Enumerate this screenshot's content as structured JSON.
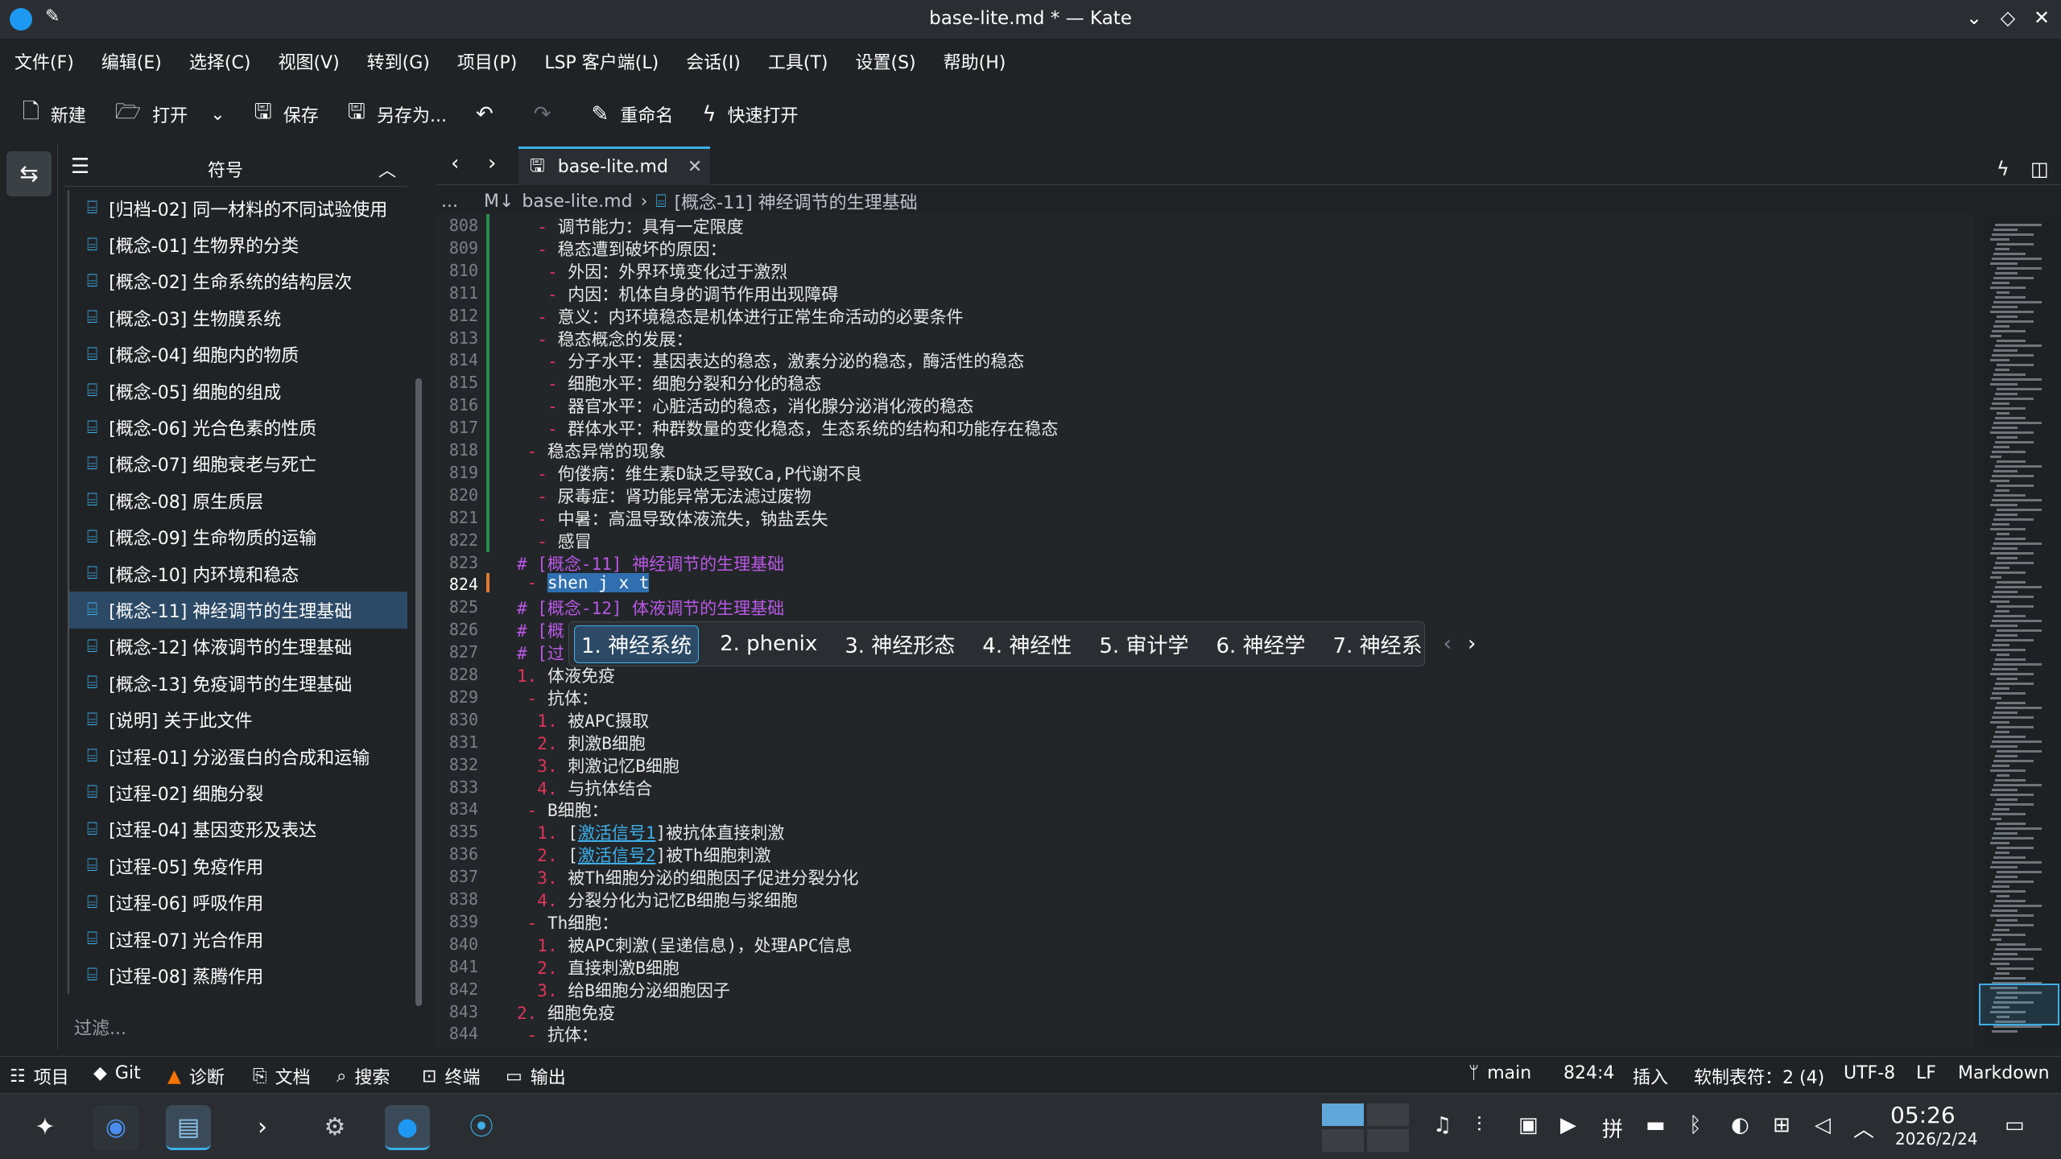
{
  "window": {
    "title": "base-lite.md * — Kate"
  },
  "menu": [
    "文件(F)",
    "编辑(E)",
    "选择(C)",
    "视图(V)",
    "转到(G)",
    "项目(P)",
    "LSP 客户端(L)",
    "会话(I)",
    "工具(T)",
    "设置(S)",
    "帮助(H)"
  ],
  "toolbar": {
    "new": "新建",
    "open": "打开",
    "save": "保存",
    "save_as": "另存为...",
    "rename": "重命名",
    "quick_open": "快速打开"
  },
  "symbols": {
    "title": "符号",
    "items": [
      "[归档-02] 同一材料的不同试验使用",
      "[概念-01] 生物界的分类",
      "[概念-02] 生命系统的结构层次",
      "[概念-03] 生物膜系统",
      "[概念-04] 细胞内的物质",
      "[概念-05] 细胞的组成",
      "[概念-06] 光合色素的性质",
      "[概念-07] 细胞衰老与死亡",
      "[概念-08] 原生质层",
      "[概念-09] 生命物质的运输",
      "[概念-10] 内环境和稳态",
      "[概念-11] 神经调节的生理基础",
      "[概念-12] 体液调节的生理基础",
      "[概念-13] 免疫调节的生理基础",
      "[说明] 关于此文件",
      "[过程-01] 分泌蛋白的合成和运输",
      "[过程-02] 细胞分裂",
      "[过程-04] 基因变形及表达",
      "[过程-05] 免疫作用",
      "[过程-06] 呼吸作用",
      "[过程-07] 光合作用",
      "[过程-08] 蒸腾作用"
    ],
    "selected_index": 11,
    "filter_placeholder": "过滤..."
  },
  "tab": {
    "label": "base-lite.md"
  },
  "breadcrumb": {
    "ellipsis": "...",
    "file": "base-lite.md",
    "section": "[概念-11] 神经调节的生理基础"
  },
  "editor": {
    "lines": [
      {
        "n": "808",
        "indent": "  ",
        "mark": "-",
        "text": " 调节能力：具有一定限度"
      },
      {
        "n": "809",
        "indent": "  ",
        "mark": "-",
        "text": " 稳态遭到破坏的原因："
      },
      {
        "n": "810",
        "indent": "   ",
        "mark": "-",
        "text": " 外因：外界环境变化过于激烈"
      },
      {
        "n": "811",
        "indent": "   ",
        "mark": "-",
        "text": " 内因：机体自身的调节作用出现障碍"
      },
      {
        "n": "812",
        "indent": "  ",
        "mark": "-",
        "text": " 意义：内环境稳态是机体进行正常生命活动的必要条件"
      },
      {
        "n": "813",
        "indent": "  ",
        "mark": "-",
        "text": " 稳态概念的发展："
      },
      {
        "n": "814",
        "indent": "   ",
        "mark": "-",
        "text": " 分子水平：基因表达的稳态，激素分泌的稳态，酶活性的稳态"
      },
      {
        "n": "815",
        "indent": "   ",
        "mark": "-",
        "text": " 细胞水平：细胞分裂和分化的稳态"
      },
      {
        "n": "816",
        "indent": "   ",
        "mark": "-",
        "text": " 器官水平：心脏活动的稳态，消化腺分泌消化液的稳态"
      },
      {
        "n": "817",
        "indent": "   ",
        "mark": "-",
        "text": " 群体水平：种群数量的变化稳态，生态系统的结构和功能存在稳态"
      },
      {
        "n": "818",
        "indent": " ",
        "mark": "-",
        "text": " 稳态异常的现象"
      },
      {
        "n": "819",
        "indent": "  ",
        "mark": "-",
        "text": " 佝偻病：维生素D缺乏导致Ca,P代谢不良"
      },
      {
        "n": "820",
        "indent": "  ",
        "mark": "-",
        "text": " 尿毒症：肾功能异常无法滤过废物"
      },
      {
        "n": "821",
        "indent": "  ",
        "mark": "-",
        "text": " 中暑：高温导致体液流失，钠盐丢失"
      },
      {
        "n": "822",
        "indent": "  ",
        "mark": "-",
        "text": " 感冒"
      },
      {
        "n": "823",
        "indent": "",
        "mark": "",
        "head": "# [概念-11] 神经调节的生理基础"
      },
      {
        "n": "824",
        "indent": " ",
        "mark": "-",
        "text": " ",
        "selected": "shen j x t"
      },
      {
        "n": "825",
        "indent": "",
        "mark": "",
        "head": "# [概念-12] 体液调节的生理基础"
      },
      {
        "n": "826",
        "indent": "",
        "mark": "",
        "head": "# [概"
      },
      {
        "n": "827",
        "indent": "",
        "mark": "",
        "head": "# [过"
      },
      {
        "n": "828",
        "indent": "",
        "mark": "1.",
        "text": " 体液免疫"
      },
      {
        "n": "829",
        "indent": " ",
        "mark": "-",
        "text": " 抗体："
      },
      {
        "n": "830",
        "indent": "  ",
        "mark": "1.",
        "text": " 被APC摄取"
      },
      {
        "n": "831",
        "indent": "  ",
        "mark": "2.",
        "text": " 刺激B细胞"
      },
      {
        "n": "832",
        "indent": "  ",
        "mark": "3.",
        "text": " 刺激记忆B细胞"
      },
      {
        "n": "833",
        "indent": "  ",
        "mark": "4.",
        "text": " 与抗体结合"
      },
      {
        "n": "834",
        "indent": " ",
        "mark": "-",
        "text": " B细胞："
      },
      {
        "n": "835",
        "indent": "  ",
        "mark": "1.",
        "text": " [",
        "link": "激活信号1",
        "after": "]被抗体直接刺激"
      },
      {
        "n": "836",
        "indent": "  ",
        "mark": "2.",
        "text": " [",
        "link": "激活信号2",
        "after": "]被Th细胞刺激"
      },
      {
        "n": "837",
        "indent": "  ",
        "mark": "3.",
        "text": " 被Th细胞分泌的细胞因子促进分裂分化"
      },
      {
        "n": "838",
        "indent": "  ",
        "mark": "4.",
        "text": " 分裂分化为记忆B细胞与浆细胞"
      },
      {
        "n": "839",
        "indent": " ",
        "mark": "-",
        "text": " Th细胞："
      },
      {
        "n": "840",
        "indent": "  ",
        "mark": "1.",
        "text": " 被APC刺激(呈递信息)，处理APC信息"
      },
      {
        "n": "841",
        "indent": "  ",
        "mark": "2.",
        "text": " 直接刺激B细胞"
      },
      {
        "n": "842",
        "indent": "  ",
        "mark": "3.",
        "text": " 给B细胞分泌细胞因子"
      },
      {
        "n": "843",
        "indent": "",
        "mark": "2.",
        "text": " 细胞免疫"
      },
      {
        "n": "844",
        "indent": " ",
        "mark": "-",
        "text": " 抗体："
      }
    ],
    "current_line": "824"
  },
  "ime": {
    "candidates": [
      "1. 神经系统",
      "2. phenix",
      "3. 神经形态",
      "4. 神经性",
      "5. 审计学",
      "6. 神经学",
      "7. 神经系"
    ],
    "active_index": 0
  },
  "statusbar": {
    "project": "项目",
    "git": "Git",
    "diagnostics": "诊断",
    "documents": "文档",
    "search": "搜索",
    "terminal": "终端",
    "output": "输出",
    "branch": "main",
    "cursor": "824:4",
    "mode": "插入",
    "indent": "软制表符：2 (4)",
    "encoding": "UTF-8",
    "eol": "LF",
    "syntax": "Markdown"
  },
  "taskbar": {
    "time": "05:26",
    "date": "2026/2/24"
  },
  "colors": {
    "accent": "#3daee9",
    "list_marker": "#e0345a",
    "heading": "#b958e6",
    "selection": "#2f6fb0"
  }
}
